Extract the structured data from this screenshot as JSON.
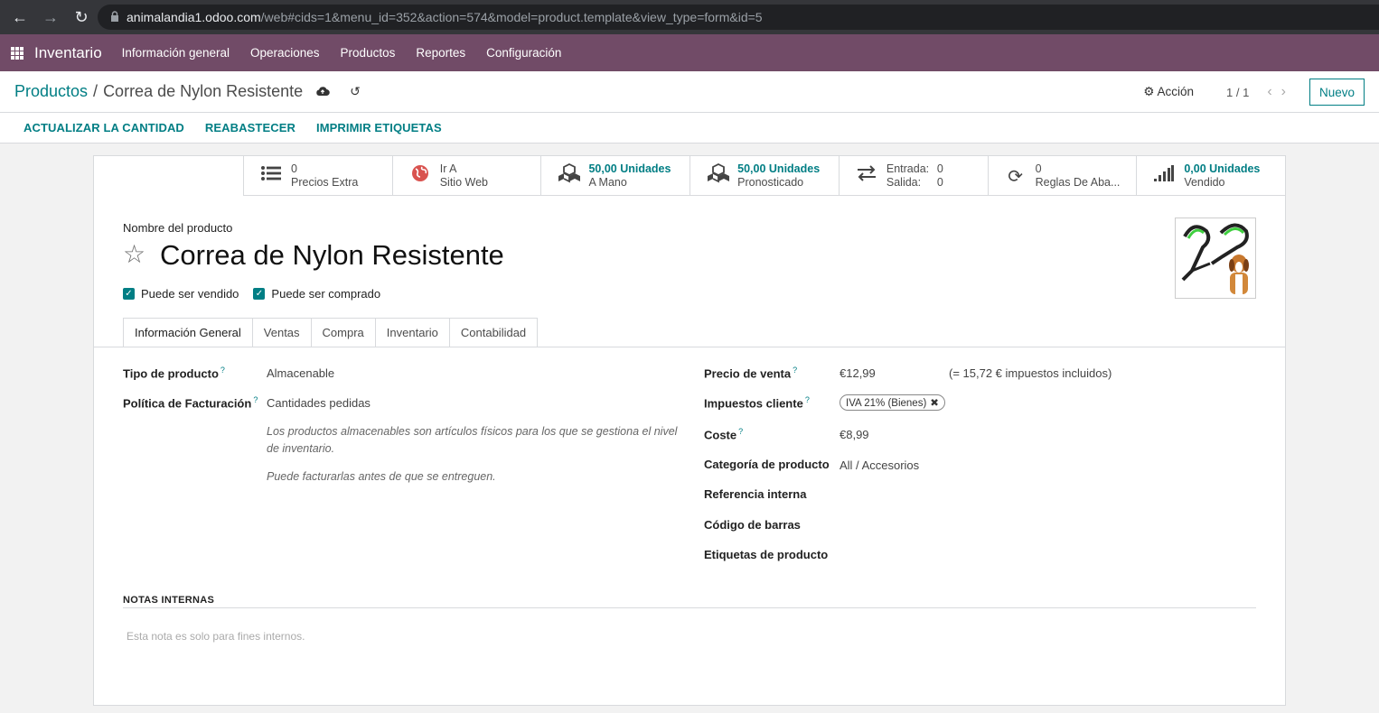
{
  "browser": {
    "url_host": "animalandia1.odoo.com",
    "url_path": "/web#cids=1&menu_id=352&action=574&model=product.template&view_type=form&id=5"
  },
  "navbar": {
    "app_name": "Inventario",
    "menu": [
      "Información general",
      "Operaciones",
      "Productos",
      "Reportes",
      "Configuración"
    ]
  },
  "control_panel": {
    "breadcrumb_parent": "Productos",
    "breadcrumb_sep": "/",
    "breadcrumb_current": "Correa de Nylon Resistente",
    "action_label": "Acción",
    "pager": "1 / 1",
    "new_label": "Nuevo"
  },
  "status_buttons": [
    "ACTUALIZAR LA CANTIDAD",
    "REABASTECER",
    "IMPRIMIR ETIQUETAS"
  ],
  "smart_buttons": {
    "extra_prices": {
      "value": "0",
      "label": "Precios Extra"
    },
    "website": {
      "value": "Ir A",
      "label": "Sitio Web"
    },
    "on_hand": {
      "value": "50,00 Unidades",
      "label": "A Mano"
    },
    "forecasted": {
      "value": "50,00 Unidades",
      "label": "Pronosticado"
    },
    "in_out": {
      "in_label": "Entrada:",
      "in_value": "0",
      "out_label": "Salida:",
      "out_value": "0"
    },
    "rules": {
      "value": "0",
      "label": "Reglas De Aba..."
    },
    "sold": {
      "value": "0,00 Unidades",
      "label": "Vendido"
    }
  },
  "product": {
    "name_label": "Nombre del producto",
    "name": "Correa de Nylon Resistente",
    "can_be_sold_label": "Puede ser vendido",
    "can_be_purchased_label": "Puede ser comprado"
  },
  "tabs": [
    "Información General",
    "Ventas",
    "Compra",
    "Inventario",
    "Contabilidad"
  ],
  "general_info": {
    "product_type_label": "Tipo de producto",
    "product_type": "Almacenable",
    "invoice_policy_label": "Política de Facturación",
    "invoice_policy": "Cantidades pedidas",
    "help_1": "Los productos almacenables son artículos físicos para los que se gestiona el nivel de inventario.",
    "help_2": "Puede facturarlas antes de que se entreguen.",
    "sale_price_label": "Precio de venta",
    "sale_price": "€12,99",
    "sale_price_taxed": "(= 15,72 € impuestos incluidos)",
    "customer_taxes_label": "Impuestos cliente",
    "customer_tax_tag": "IVA 21% (Bienes)",
    "cost_label": "Coste",
    "cost": "€8,99",
    "category_label": "Categoría de producto",
    "category": "All / Accesorios",
    "internal_ref_label": "Referencia interna",
    "barcode_label": "Código de barras",
    "tags_label": "Etiquetas de producto"
  },
  "notes": {
    "heading": "NOTAS INTERNAS",
    "placeholder": "Esta nota es solo para fines internos."
  },
  "help_marker": "?",
  "colors": {
    "navbar": "#714b67",
    "accent": "#017e84"
  }
}
